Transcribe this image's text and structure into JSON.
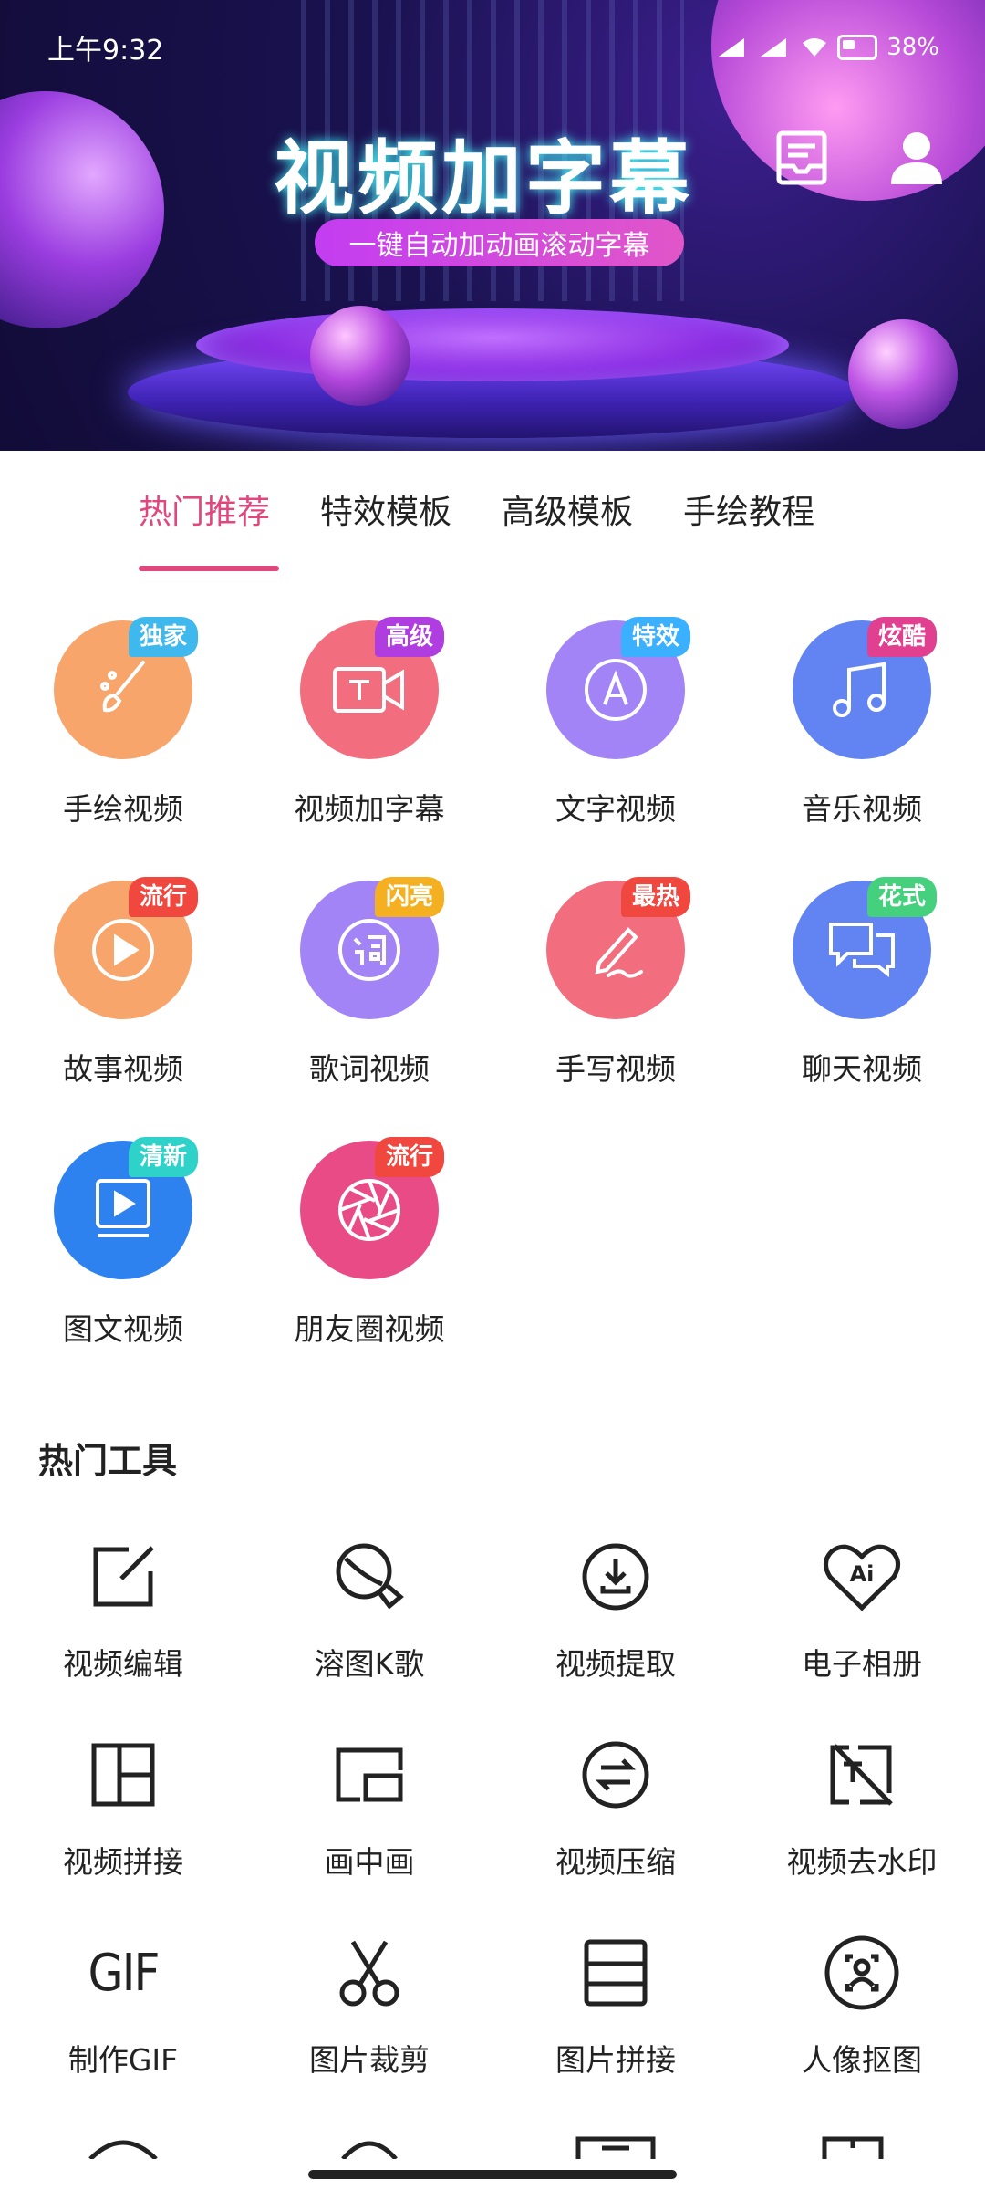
{
  "status_bar": {
    "time": "上午9:32",
    "battery": "38%"
  },
  "banner": {
    "title": "视频加字幕",
    "subtitle": "一键自动加动画滚动字幕"
  },
  "tabs": [
    {
      "label": "热门推荐",
      "active": true
    },
    {
      "label": "特效模板",
      "active": false
    },
    {
      "label": "高级模板",
      "active": false
    },
    {
      "label": "手绘教程",
      "active": false
    }
  ],
  "features": [
    {
      "label": "手绘视频",
      "badge": "独家",
      "icon": "brush-icon",
      "color": "#f8a56b",
      "badge_color": "#3fb8ee"
    },
    {
      "label": "视频加字幕",
      "badge": "高级",
      "icon": "video-text-icon",
      "color": "#f26e7f",
      "badge_color": "#b03de0"
    },
    {
      "label": "文字视频",
      "badge": "特效",
      "icon": "letter-a-icon",
      "color": "#a284f7",
      "badge_color": "#3ab0ff"
    },
    {
      "label": "音乐视频",
      "badge": "炫酷",
      "icon": "music-note-icon",
      "color": "#6184f2",
      "badge_color": "#e0408f"
    },
    {
      "label": "故事视频",
      "badge": "流行",
      "icon": "play-icon",
      "color": "#f8a56b",
      "badge_color": "#f0473f"
    },
    {
      "label": "歌词视频",
      "badge": "闪亮",
      "icon": "lyric-icon",
      "color": "#a284f7",
      "badge_color": "#f5b021"
    },
    {
      "label": "手写视频",
      "badge": "最热",
      "icon": "pen-icon",
      "color": "#f26e7f",
      "badge_color": "#f0473f"
    },
    {
      "label": "聊天视频",
      "badge": "花式",
      "icon": "chat-icon",
      "color": "#6184f2",
      "badge_color": "#45d07e"
    },
    {
      "label": "图文视频",
      "badge": "清新",
      "icon": "image-text-icon",
      "color": "#2d82f0",
      "badge_color": "#2fd2c8"
    },
    {
      "label": "朋友圈视频",
      "badge": "流行",
      "icon": "aperture-icon",
      "color": "#e94b87",
      "badge_color": "#f0473f"
    }
  ],
  "tools_section_title": "热门工具",
  "tools": [
    {
      "label": "视频编辑",
      "icon": "edit-icon"
    },
    {
      "label": "溶图K歌",
      "icon": "karaoke-icon"
    },
    {
      "label": "视频提取",
      "icon": "download-icon"
    },
    {
      "label": "电子相册",
      "icon": "ai-heart-icon",
      "icon_text": "Ai"
    },
    {
      "label": "视频拼接",
      "icon": "layout-icon"
    },
    {
      "label": "画中画",
      "icon": "pip-icon"
    },
    {
      "label": "视频压缩",
      "icon": "compress-icon"
    },
    {
      "label": "视频去水印",
      "icon": "remove-watermark-icon"
    },
    {
      "label": "制作GIF",
      "icon": "gif-icon",
      "icon_text": "GIF"
    },
    {
      "label": "图片裁剪",
      "icon": "scissors-icon"
    },
    {
      "label": "图片拼接",
      "icon": "image-stitch-icon"
    },
    {
      "label": "人像抠图",
      "icon": "portrait-cutout-icon"
    }
  ]
}
